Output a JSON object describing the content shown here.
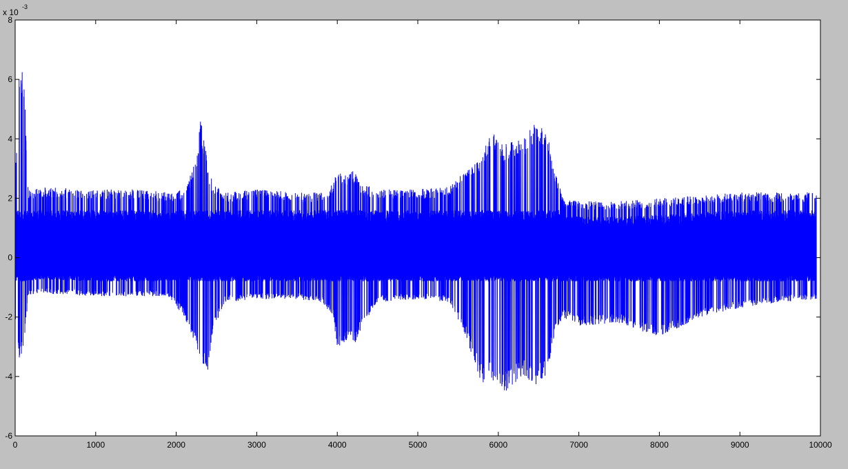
{
  "colors": {
    "figure_background": "#c0c0c0",
    "axes_background": "#ffffff",
    "line": "#0000ff",
    "axes": "#000000"
  },
  "chart_data": {
    "type": "line",
    "title": "",
    "xlabel": "",
    "ylabel": "",
    "xlim": [
      0,
      10000
    ],
    "ylim": [
      -0.006,
      0.008
    ],
    "x_ticks": [
      0,
      1000,
      2000,
      3000,
      4000,
      5000,
      6000,
      7000,
      8000,
      9000,
      10000
    ],
    "x_tick_labels": [
      "0",
      "1000",
      "2000",
      "3000",
      "4000",
      "5000",
      "6000",
      "7000",
      "8000",
      "9000",
      "10000"
    ],
    "y_ticks": [
      -0.006,
      -0.004,
      -0.002,
      0,
      0.002,
      0.004,
      0.006,
      0.008
    ],
    "y_tick_labels": [
      "-6",
      "-4",
      "-2",
      "0",
      "2",
      "4",
      "6",
      "8"
    ],
    "y_exponent_label": {
      "base": "x 10",
      "exponent": "-3"
    },
    "grid": false,
    "legend": "none",
    "series": [
      {
        "color": "#0000ff",
        "n_points": 9950,
        "x_range": [
          1,
          9950
        ],
        "envelope": {
          "x": [
            0,
            50,
            100,
            130,
            160,
            300,
            1000,
            1500,
            1900,
            2100,
            2250,
            2300,
            2400,
            2450,
            2600,
            3000,
            3500,
            3800,
            3950,
            4000,
            4150,
            4200,
            4300,
            4500,
            5000,
            5400,
            5600,
            5800,
            5900,
            6050,
            6300,
            6450,
            6600,
            6700,
            6800,
            7000,
            7500,
            8000,
            8500,
            9000,
            9500,
            9950
          ],
          "upper": [
            0.0026,
            0.0065,
            0.0063,
            0.0048,
            0.0023,
            0.0024,
            0.0023,
            0.0023,
            0.0022,
            0.0023,
            0.0033,
            0.0048,
            0.003,
            0.0026,
            0.0022,
            0.0023,
            0.0022,
            0.0022,
            0.0025,
            0.003,
            0.0028,
            0.003,
            0.0025,
            0.0023,
            0.0023,
            0.0024,
            0.003,
            0.0034,
            0.0043,
            0.0038,
            0.004,
            0.0045,
            0.0043,
            0.003,
            0.002,
            0.0019,
            0.0019,
            0.002,
            0.0021,
            0.0022,
            0.0022,
            0.0022
          ],
          "lower": [
            -0.002,
            -0.0034,
            -0.0032,
            -0.0024,
            -0.0013,
            -0.0012,
            -0.0013,
            -0.0013,
            -0.0013,
            -0.002,
            -0.003,
            -0.0036,
            -0.0038,
            -0.0025,
            -0.0015,
            -0.0014,
            -0.0014,
            -0.0015,
            -0.002,
            -0.003,
            -0.0028,
            -0.003,
            -0.0024,
            -0.0015,
            -0.0014,
            -0.0015,
            -0.0027,
            -0.0043,
            -0.004,
            -0.0046,
            -0.004,
            -0.0043,
            -0.004,
            -0.0026,
            -0.002,
            -0.0023,
            -0.0022,
            -0.0027,
            -0.002,
            -0.0017,
            -0.0015,
            -0.0014
          ]
        },
        "dense_band": {
          "upper": 0.0016,
          "lower": -0.0008
        }
      }
    ]
  }
}
